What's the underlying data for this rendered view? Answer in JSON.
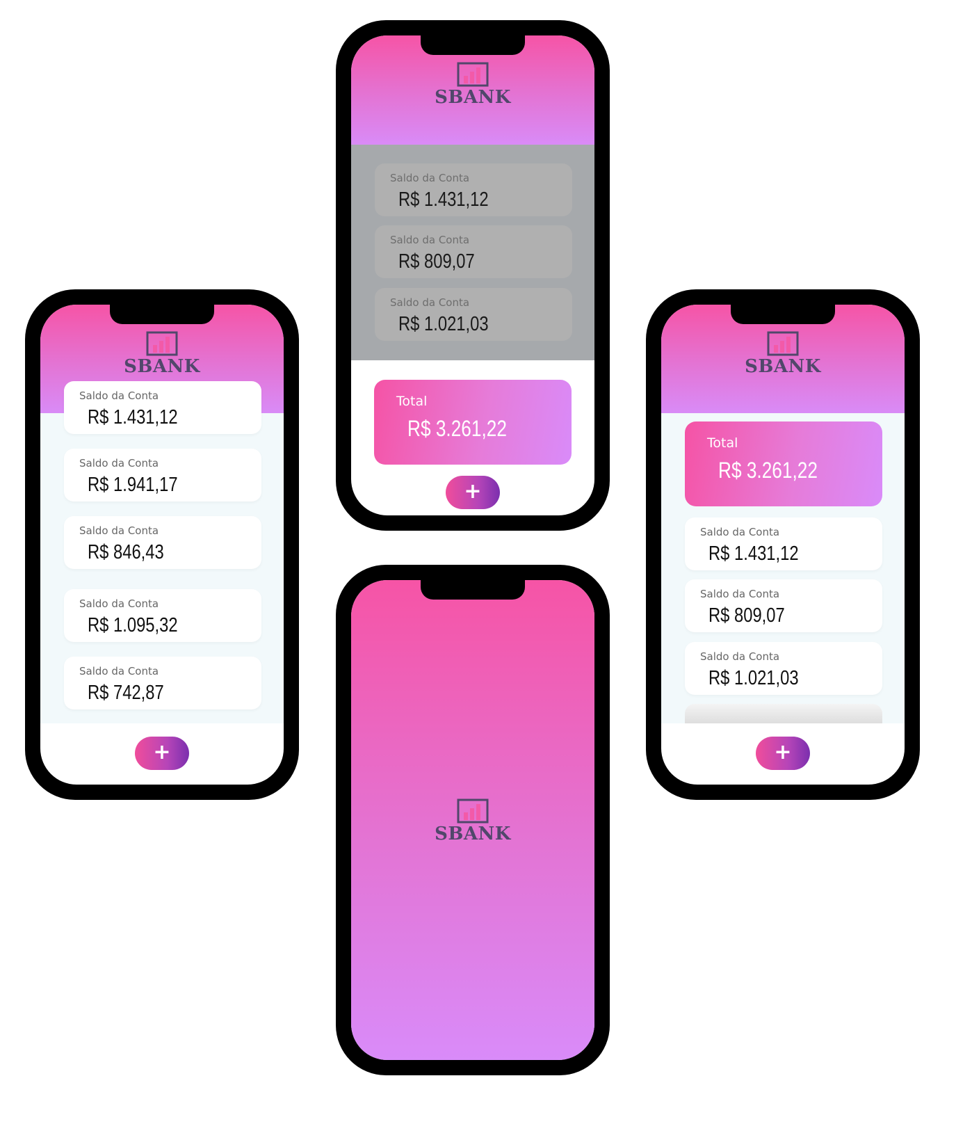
{
  "brand": {
    "name": "SBANK"
  },
  "colors": {
    "gradient_top": "#f654a6",
    "gradient_bottom": "#d98bf9",
    "logo_text": "#51476b",
    "fab_end": "#7b2fae"
  },
  "icons": {
    "logo": "bar-chart-icon",
    "add": "plus-icon"
  },
  "screens": {
    "left": {
      "accounts": [
        {
          "label": "Saldo da Conta",
          "value": "R$ 1.431,12"
        },
        {
          "label": "Saldo da Conta",
          "value": "R$ 1.941,17"
        },
        {
          "label": "Saldo da Conta",
          "value": "R$ 846,43"
        },
        {
          "label": "Saldo da Conta",
          "value": "R$ 1.095,32"
        },
        {
          "label": "Saldo da Conta",
          "value": "R$ 742,87"
        }
      ],
      "fab": "+"
    },
    "top": {
      "accounts": [
        {
          "label": "Saldo da Conta",
          "value": "R$ 1.431,12"
        },
        {
          "label": "Saldo da Conta",
          "value": "R$ 809,07"
        },
        {
          "label": "Saldo da Conta",
          "value": "R$ 1.021,03"
        }
      ],
      "total": {
        "label": "Total",
        "value": "R$ 3.261,22"
      },
      "fab": "+"
    },
    "right": {
      "total": {
        "label": "Total",
        "value": "R$ 3.261,22"
      },
      "accounts": [
        {
          "label": "Saldo da Conta",
          "value": "R$ 1.431,12"
        },
        {
          "label": "Saldo da Conta",
          "value": "R$ 809,07"
        },
        {
          "label": "Saldo da Conta",
          "value": "R$ 1.021,03"
        }
      ],
      "fab": "+"
    }
  }
}
